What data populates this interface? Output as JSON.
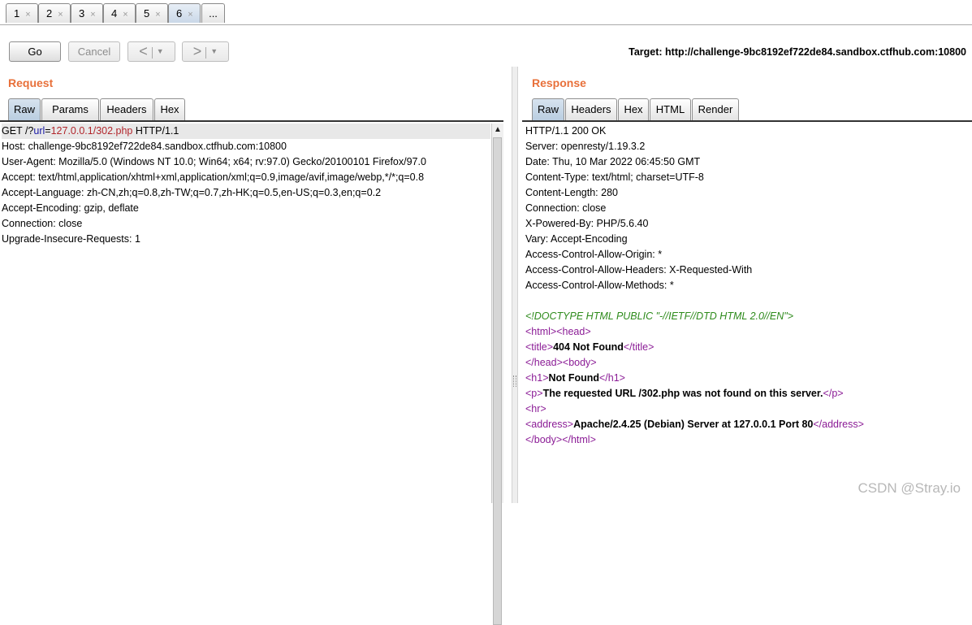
{
  "tabs": [
    {
      "label": "1",
      "close": "×"
    },
    {
      "label": "2",
      "close": "×"
    },
    {
      "label": "3",
      "close": "×"
    },
    {
      "label": "4",
      "close": "×"
    },
    {
      "label": "5",
      "close": "×"
    },
    {
      "label": "6",
      "close": "×",
      "active": true
    }
  ],
  "more_tabs_label": "...",
  "toolbar": {
    "go_label": "Go",
    "cancel_label": "Cancel",
    "back_arrow": "<",
    "forward_arrow": ">",
    "dropdown_glyph": "▼",
    "target_label": "Target: http://challenge-9bc8192ef722de84.sandbox.ctfhub.com:10800"
  },
  "request": {
    "title": "Request",
    "tabs": [
      "Raw",
      "Params",
      "Headers",
      "Hex"
    ],
    "first_line": {
      "method": "GET /?",
      "param": "url",
      "eq": "=",
      "value": "127.0.0.1/302.php",
      "proto": " HTTP/1.1"
    },
    "lines": [
      "Host: challenge-9bc8192ef722de84.sandbox.ctfhub.com:10800",
      "User-Agent: Mozilla/5.0 (Windows NT 10.0; Win64; x64; rv:97.0) Gecko/20100101 Firefox/97.0",
      "Accept: text/html,application/xhtml+xml,application/xml;q=0.9,image/avif,image/webp,*/*;q=0.8",
      "Accept-Language: zh-CN,zh;q=0.8,zh-TW;q=0.7,zh-HK;q=0.5,en-US;q=0.3,en;q=0.2",
      "Accept-Encoding: gzip, deflate",
      "Connection: close",
      "Upgrade-Insecure-Requests: 1"
    ]
  },
  "response": {
    "title": "Response",
    "tabs": [
      "Raw",
      "Headers",
      "Hex",
      "HTML",
      "Render"
    ],
    "header_lines": [
      "HTTP/1.1 200 OK",
      "Server: openresty/1.19.3.2",
      "Date: Thu, 10 Mar 2022 06:45:50 GMT",
      "Content-Type: text/html; charset=UTF-8",
      "Content-Length: 280",
      "Connection: close",
      "X-Powered-By: PHP/5.6.40",
      "Vary: Accept-Encoding",
      "Access-Control-Allow-Origin: *",
      "Access-Control-Allow-Headers: X-Requested-With",
      "Access-Control-Allow-Methods: *"
    ],
    "body": {
      "doctype": "<!DOCTYPE HTML PUBLIC \"-//IETF//DTD HTML 2.0//EN\">",
      "html_open": "<html>",
      "head_open": "<head>",
      "title_open": "<title>",
      "title_text": "404 Not Found",
      "title_close": "</title>",
      "head_close": "</head>",
      "body_open": "<body>",
      "h1_open": "<h1>",
      "h1_text": "Not Found",
      "h1_close": "</h1>",
      "p_open": "<p>",
      "p_text": "The requested URL /302.php was not found on this server.",
      "p_close": "</p>",
      "hr": "<hr>",
      "address_open": "<address>",
      "address_text": "Apache/2.4.25 (Debian) Server at 127.0.0.1 Port 80",
      "address_close": "</address>",
      "body_close": "</body>",
      "html_close": "</html>"
    }
  },
  "watermark": "CSDN @Stray.io"
}
